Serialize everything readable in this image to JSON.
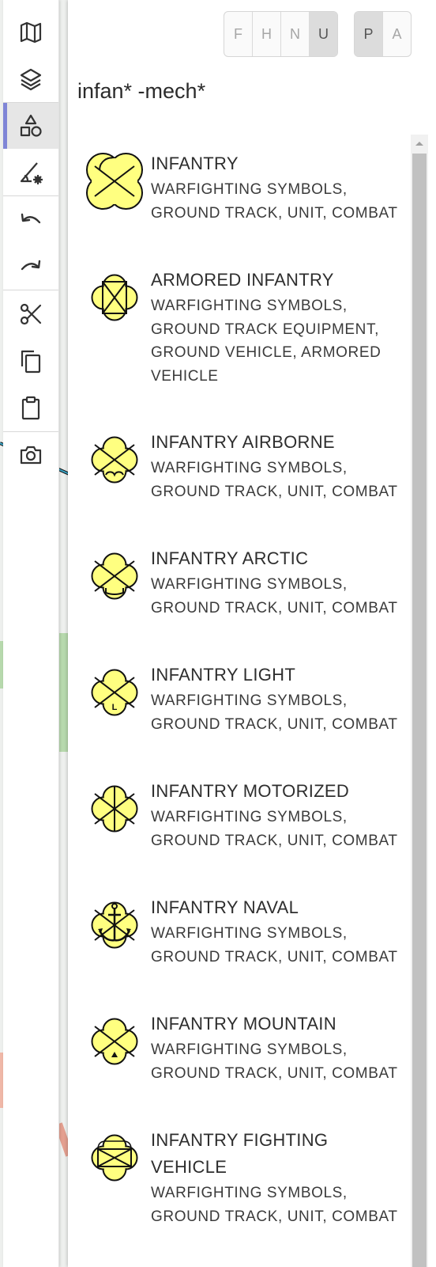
{
  "toolbar": {
    "tools": [
      {
        "name": "map-icon"
      },
      {
        "name": "layers-icon"
      },
      {
        "name": "shapes-icon"
      },
      {
        "name": "draw-settings-icon"
      },
      {
        "name": "undo-icon"
      },
      {
        "name": "redo-icon"
      },
      {
        "name": "cut-icon"
      },
      {
        "name": "copy-icon"
      },
      {
        "name": "paste-icon"
      },
      {
        "name": "camera-icon"
      }
    ],
    "active_tool": "shapes-icon",
    "accent_color": "#7f85d6"
  },
  "identity_filter": {
    "options": [
      "F",
      "H",
      "N",
      "U"
    ],
    "selected": "U"
  },
  "status_filter": {
    "options": [
      "P",
      "A"
    ],
    "selected": "P"
  },
  "search": {
    "query": "infan* -mech*"
  },
  "symbol_fill_color": "#ffff80",
  "results": [
    {
      "title": "INFANTRY",
      "description": "WARFIGHTING SYMBOLS, GROUND TRACK, UNIT, COMBAT",
      "icon": "infantry-symbol-icon"
    },
    {
      "title": "ARMORED INFANTRY",
      "description": "WARFIGHTING SYMBOLS, GROUND TRACK EQUIPMENT, GROUND VEHICLE, ARMORED VEHICLE",
      "icon": "armored-infantry-symbol-icon"
    },
    {
      "title": "INFANTRY AIRBORNE",
      "description": "WARFIGHTING SYMBOLS, GROUND TRACK, UNIT, COMBAT",
      "icon": "infantry-airborne-symbol-icon"
    },
    {
      "title": "INFANTRY ARCTIC",
      "description": "WARFIGHTING SYMBOLS, GROUND TRACK, UNIT, COMBAT",
      "icon": "infantry-arctic-symbol-icon"
    },
    {
      "title": "INFANTRY LIGHT",
      "description": "WARFIGHTING SYMBOLS, GROUND TRACK, UNIT, COMBAT",
      "icon": "infantry-light-symbol-icon",
      "symbol_letter": "L"
    },
    {
      "title": "INFANTRY MOTORIZED",
      "description": "WARFIGHTING SYMBOLS, GROUND TRACK, UNIT, COMBAT",
      "icon": "infantry-motorized-symbol-icon"
    },
    {
      "title": "INFANTRY NAVAL",
      "description": "WARFIGHTING SYMBOLS, GROUND TRACK, UNIT, COMBAT",
      "icon": "infantry-naval-symbol-icon"
    },
    {
      "title": "INFANTRY MOUNTAIN",
      "description": "WARFIGHTING SYMBOLS, GROUND TRACK, UNIT, COMBAT",
      "icon": "infantry-mountain-symbol-icon"
    },
    {
      "title": "INFANTRY FIGHTING VEHICLE",
      "description": "WARFIGHTING SYMBOLS, GROUND TRACK, UNIT, COMBAT",
      "icon": "infantry-fighting-vehicle-symbol-icon"
    }
  ]
}
